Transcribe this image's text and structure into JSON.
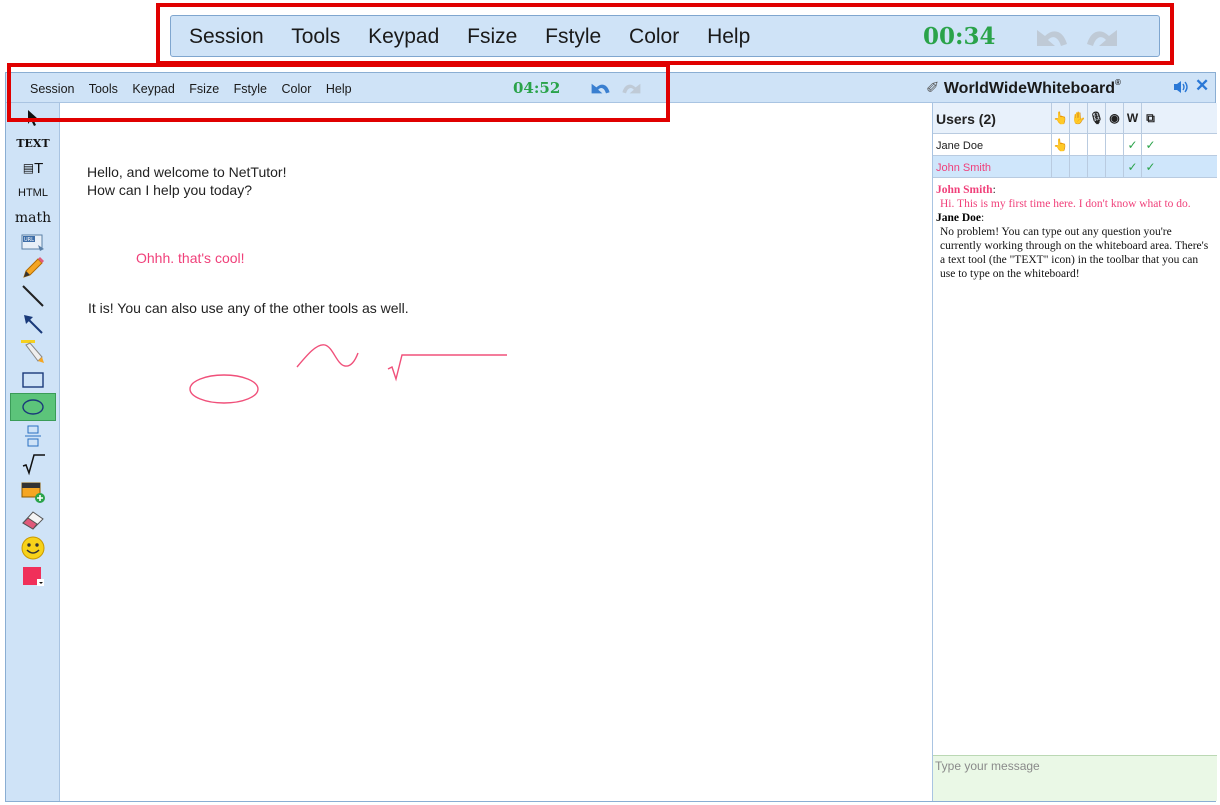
{
  "menu": [
    "Session",
    "Tools",
    "Keypad",
    "Fsize",
    "Fstyle",
    "Color",
    "Help"
  ],
  "timer_zoom": "00:34",
  "timer": "04:52",
  "brand": {
    "name": "WorldWideWhiteboard",
    "mark": "®"
  },
  "tools": [
    "select-arrow",
    "TEXT",
    "font-text",
    "HTML",
    "math",
    "url",
    "pencil",
    "line",
    "arrow",
    "highlighter",
    "rectangle",
    "ellipse",
    "equation",
    "sqrt",
    "insert-image",
    "eraser",
    "smiley",
    "color-picker"
  ],
  "tool_labels": {
    "text": "TEXT",
    "html": "HTML",
    "math": "math",
    "fontT": "T"
  },
  "canvas": {
    "greeting": [
      "Hello, and welcome to NetTutor!",
      "How can I help you today?"
    ],
    "reply": "Ohhh. that's cool!",
    "note": "It is! You can also use any of the other tools as well."
  },
  "users": {
    "header": "Users (2)",
    "col_icons": [
      "pointer-icon",
      "hand-icon",
      "mic-icon",
      "webcam-icon",
      "W",
      "share-icon"
    ],
    "w_label": "W",
    "rows": [
      {
        "name": "Jane Doe",
        "pointer": true,
        "w": "✓",
        "share": "✓",
        "color": "#222222"
      },
      {
        "name": "John Smith",
        "pointer": false,
        "w": "✓",
        "share": "✓",
        "color": "#f0407a"
      }
    ]
  },
  "chat": [
    {
      "author": "John Smith",
      "author_color": "#f0407a",
      "text": "Hi. This is my first time here. I don't know what to do.",
      "color": "#f0407a"
    },
    {
      "author": "Jane Doe",
      "author_color": "#000000",
      "text": "No problem! You can type out any question you're currently working through on the whiteboard area. There's a text tool (the \"TEXT\" icon) in the toolbar that you can use to type on the whiteboard!",
      "color": "#111111"
    }
  ],
  "message_placeholder": "Type your message",
  "colors": {
    "accent_green": "#2aa34a",
    "bar_bg": "#cfe3f7",
    "highlight_red": "#e00000",
    "pink": "#f0407a"
  }
}
